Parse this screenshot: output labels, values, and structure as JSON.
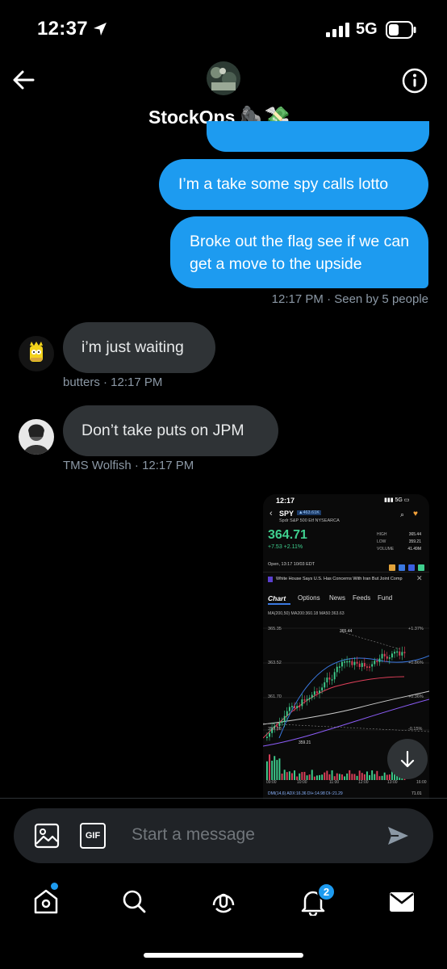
{
  "status_bar": {
    "time": "12:37",
    "network": "5G"
  },
  "header": {
    "title": "StockOps",
    "title_emoji": "🦍💸"
  },
  "messages": [
    {
      "id": "m1",
      "side": "right",
      "text": "I’m a take some spy calls lotto"
    },
    {
      "id": "m2",
      "side": "right",
      "text": "Broke out the flag see if we can get a move to the upside"
    },
    {
      "id": "m3",
      "side": "left",
      "sender": "butters",
      "text": "i’m just waiting"
    },
    {
      "id": "m4",
      "side": "left",
      "sender": "TMS Wolfish",
      "text": "Don’t take puts on JPM"
    }
  ],
  "meta": {
    "seen_time": "12:17 PM",
    "seen_text": "· Seen by 5 people",
    "m3_meta": "butters · 12:17 PM",
    "m4_meta": "TMS Wolfish · 12:17 PM"
  },
  "attachment": {
    "time": "12:17",
    "ticker": "SPY",
    "badge": "▲463.61K",
    "name": "Spdr S&P 500 Etf NYSEARCA",
    "price": "364.71",
    "change": "+7.53 +2.11%",
    "stats": [
      {
        "label": "HIGH",
        "value": "365.44"
      },
      {
        "label": "LOW",
        "value": "359.21"
      },
      {
        "label": "VOLUME",
        "value": "41.49M"
      }
    ],
    "open_text": "Open, 13:17 10/03 EDT",
    "headline": "White House Says U.S. Has Concerns With Iran But Joint Comp",
    "tabs": [
      "Chart",
      "Options",
      "News",
      "Feeds",
      "Fund"
    ],
    "ma_line": "MA(200,50)  MA200:360.18  MA50:363.63",
    "y_labels": [
      "365.35",
      "363.52",
      "361.70",
      "359.88"
    ],
    "right_labels": [
      "+1.37%",
      "+0.86%",
      "+0.36%",
      "-0.15%"
    ],
    "annot_high": "365.44",
    "annot_low": "359.21",
    "x_labels": [
      "09:00",
      "10:00",
      "11:00",
      "12:00",
      "13:00",
      "16:00"
    ],
    "dmi_text": "DMI(14,6)  ADX:16.36  DI+:14.98  DI-:21.29",
    "dmi_value": "71.01"
  },
  "composer": {
    "placeholder": "Start a message",
    "gif_label": "GIF"
  },
  "tab_bar": {
    "notifications_badge": "2"
  },
  "colors": {
    "accent": "#1d9bf0",
    "bubble_left": "#2f3336",
    "up": "#3fcf8e",
    "down": "#e0405a"
  }
}
